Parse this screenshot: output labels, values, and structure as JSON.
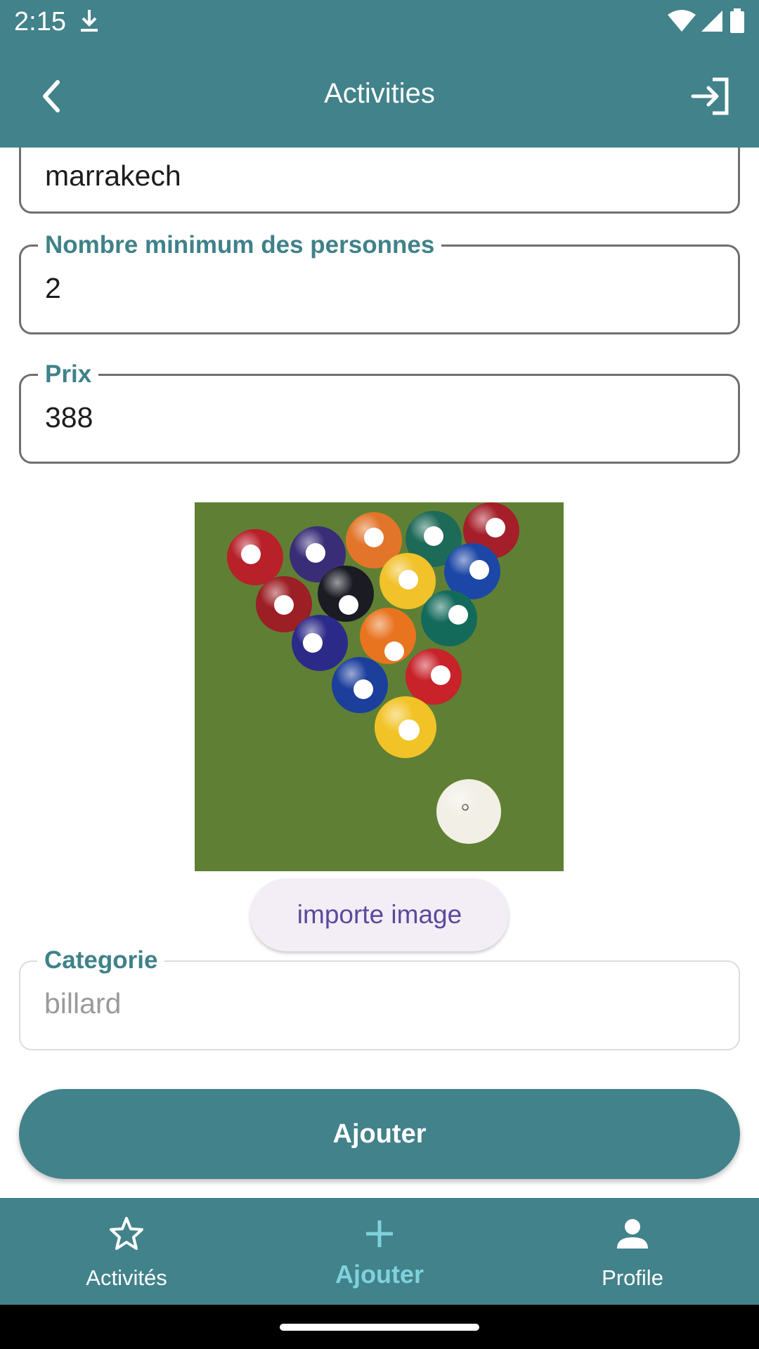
{
  "status_bar": {
    "time": "2:15"
  },
  "app_bar": {
    "title": "Activities"
  },
  "form": {
    "location": {
      "value": "marrakech"
    },
    "min_people": {
      "label": "Nombre minimum des personnes",
      "value": "2"
    },
    "price": {
      "label": "Prix",
      "value": "388"
    },
    "import_button": "importe image",
    "category": {
      "label": "Categorie",
      "value": "billard"
    },
    "submit_button": "Ajouter"
  },
  "image": {
    "subject": "billiard-balls-rack-photo"
  },
  "bottom_nav": {
    "items": [
      {
        "label": "Activités",
        "icon": "star-outline-icon"
      },
      {
        "label": "Ajouter",
        "icon": "plus-icon",
        "active": true
      },
      {
        "label": "Profile",
        "icon": "person-icon"
      }
    ]
  },
  "colors": {
    "primary": "#42828a",
    "active_nav": "#7fd2dc",
    "label": "#3f8189",
    "import_text": "#5a4a9c"
  }
}
